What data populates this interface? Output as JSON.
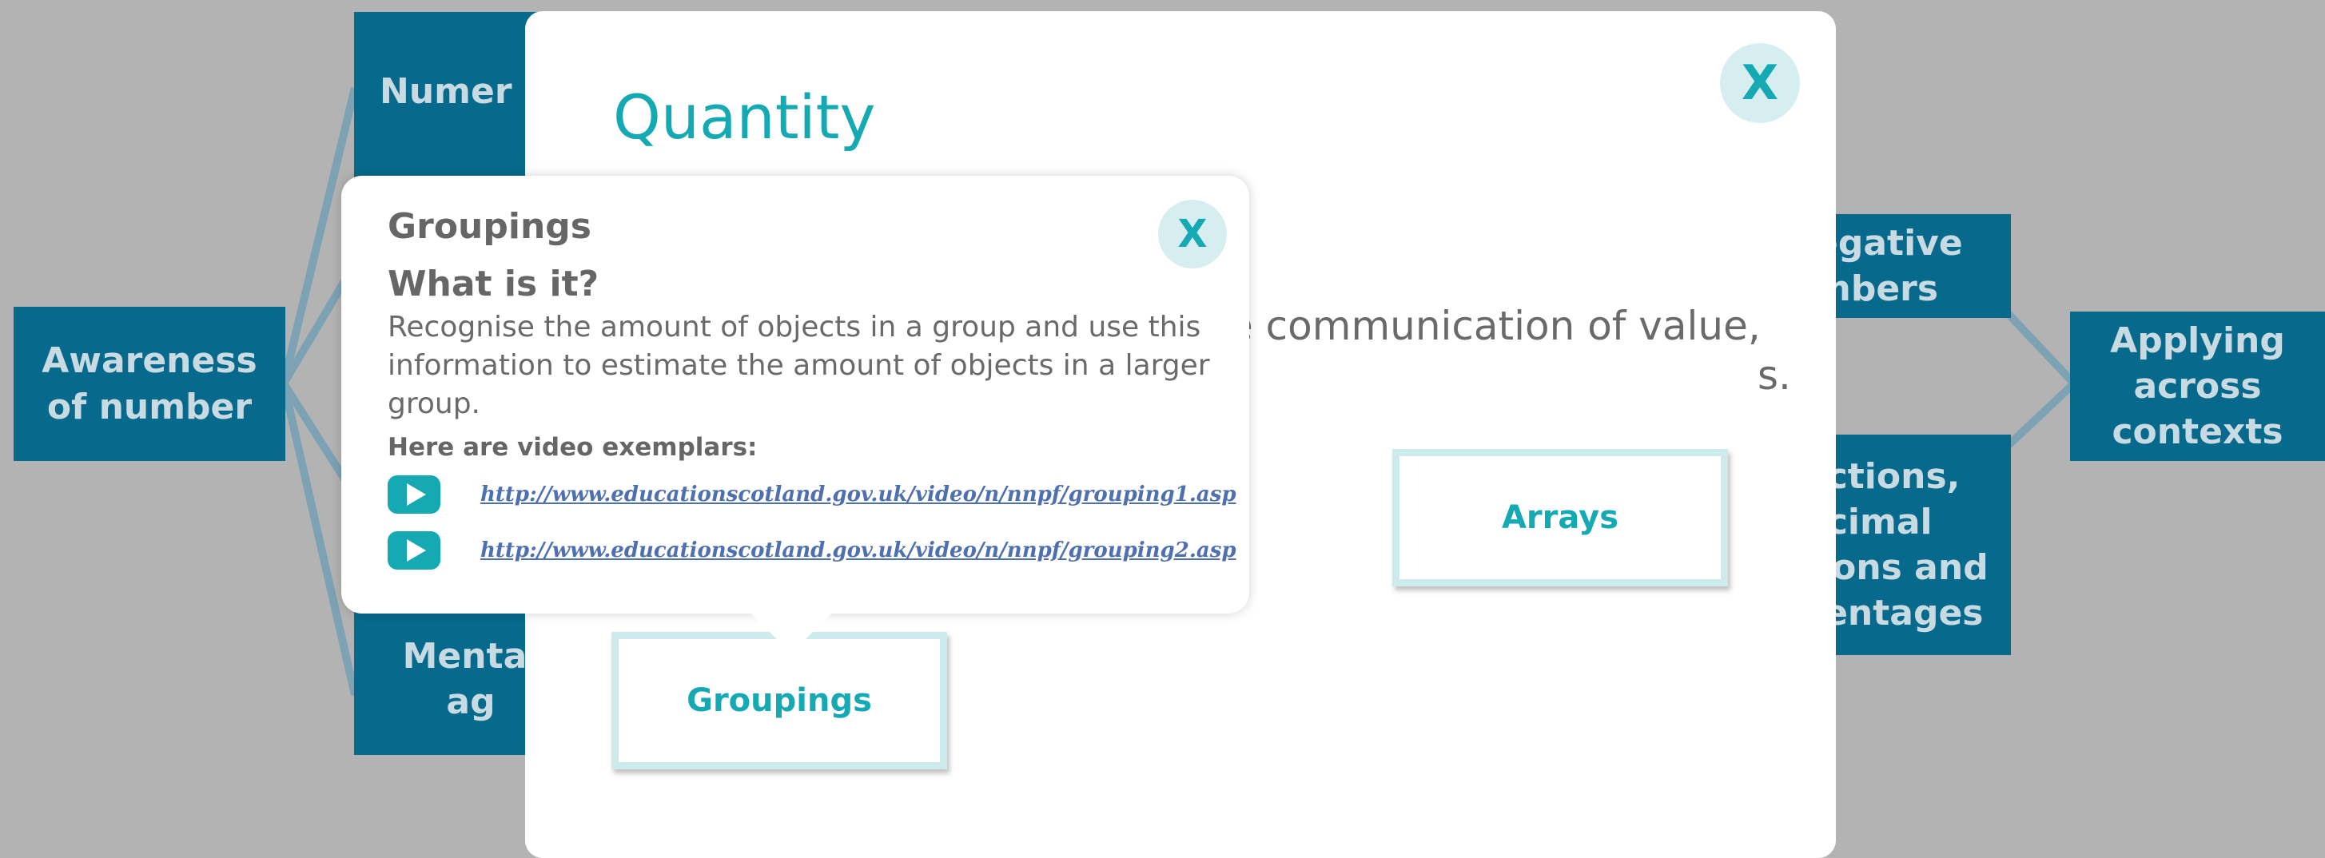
{
  "background_map": {
    "nodes": [
      {
        "id": "awareness",
        "label": "Awareness of number"
      },
      {
        "id": "numeral",
        "label": "Numer"
      },
      {
        "id": "mental",
        "label": "Mental ag"
      },
      {
        "id": "negative",
        "label": "egative mbers"
      },
      {
        "id": "fractions",
        "label": "actions, ecimal tions and centages"
      },
      {
        "id": "applying",
        "label": "Applying across contexts"
      }
    ]
  },
  "modal": {
    "title": "Quantity",
    "close_label": "X",
    "description_line1": "e communication of value,",
    "description_line2": "s.",
    "buttons": {
      "arrays": "Arrays",
      "groupings": "Groupings"
    }
  },
  "popup": {
    "title": "Groupings",
    "close_label": "X",
    "heading": "What is it?",
    "body": "Recognise the amount of objects in a group and use this information to estimate the amount of objects in a larger group.",
    "videos_label": "Here are video exemplars:",
    "videos": [
      {
        "url": "http://www.educationscotland.gov.uk/video/n/nnpf/grouping1.asp"
      },
      {
        "url": "http://www.educationscotland.gov.uk/video/n/nnpf/grouping2.asp"
      }
    ]
  },
  "colors": {
    "backdrop": "#b3b3b3",
    "node": "#076a8c",
    "node_text": "#c9dbe2",
    "accent": "#14a9b3",
    "link": "#4e6fb0"
  },
  "icons": {
    "modal_close": "close-icon",
    "popup_close": "close-icon",
    "video": "play-icon"
  }
}
